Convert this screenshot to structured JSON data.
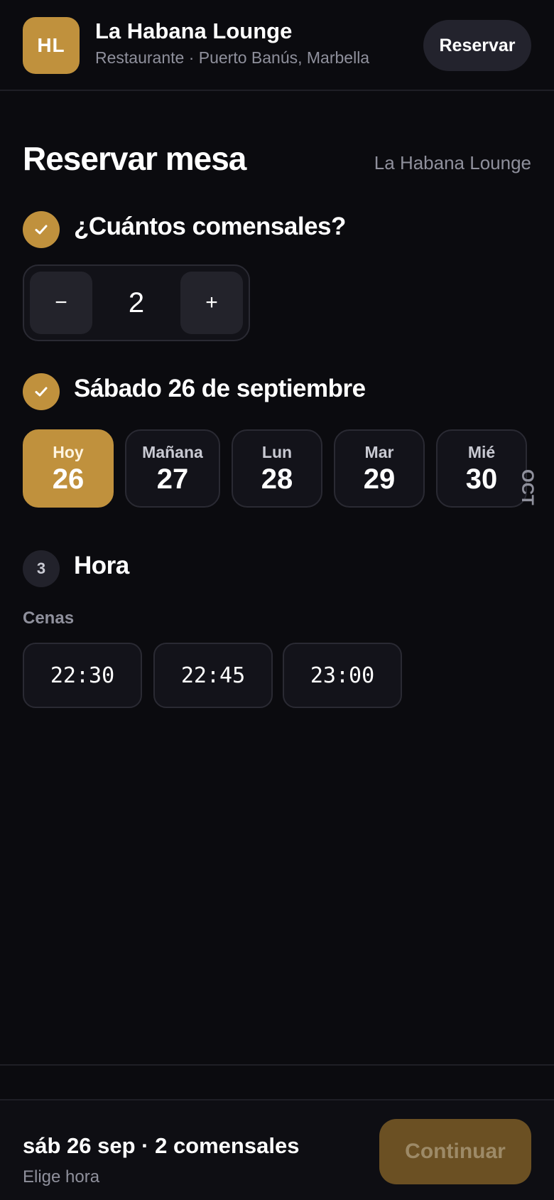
{
  "header": {
    "logo_initials": "HL",
    "venue_name": "La Habana Lounge",
    "venue_subtitle": "Restaurante · Puerto Banús, Marbella",
    "reserve_button": "Reservar"
  },
  "page": {
    "title": "Reservar mesa",
    "venue_label": "La Habana Lounge"
  },
  "steps": {
    "guests": {
      "title": "¿Cuántos comensales?",
      "status": "done",
      "value": "2",
      "minus": "−",
      "plus": "+"
    },
    "date": {
      "title": "Sábado 26 de septiembre",
      "status": "done"
    },
    "time": {
      "number": "3",
      "title": "Hora",
      "status": "pending"
    }
  },
  "days": [
    {
      "label": "Hoy",
      "number": "26",
      "selected": true
    },
    {
      "label": "Mañana",
      "number": "27",
      "selected": false
    },
    {
      "label": "Lun",
      "number": "28",
      "selected": false
    },
    {
      "label": "Mar",
      "number": "29",
      "selected": false
    },
    {
      "label": "Mié",
      "number": "30",
      "selected": false
    }
  ],
  "next_month_label": "OCT",
  "time_group": {
    "label": "Cenas",
    "slots": [
      "22:30",
      "22:45",
      "23:00"
    ]
  },
  "footer": {
    "summary": "sáb 26 sep · 2 comensales",
    "hint": "Elige hora",
    "continue_button": "Continuar"
  },
  "colors": {
    "accent": "#c0913d",
    "background": "#0b0b0f",
    "surface": "#13131a",
    "muted_text": "#8f909c",
    "continue_disabled": "#6b5023"
  },
  "icons": {
    "step_done": "check-icon"
  }
}
